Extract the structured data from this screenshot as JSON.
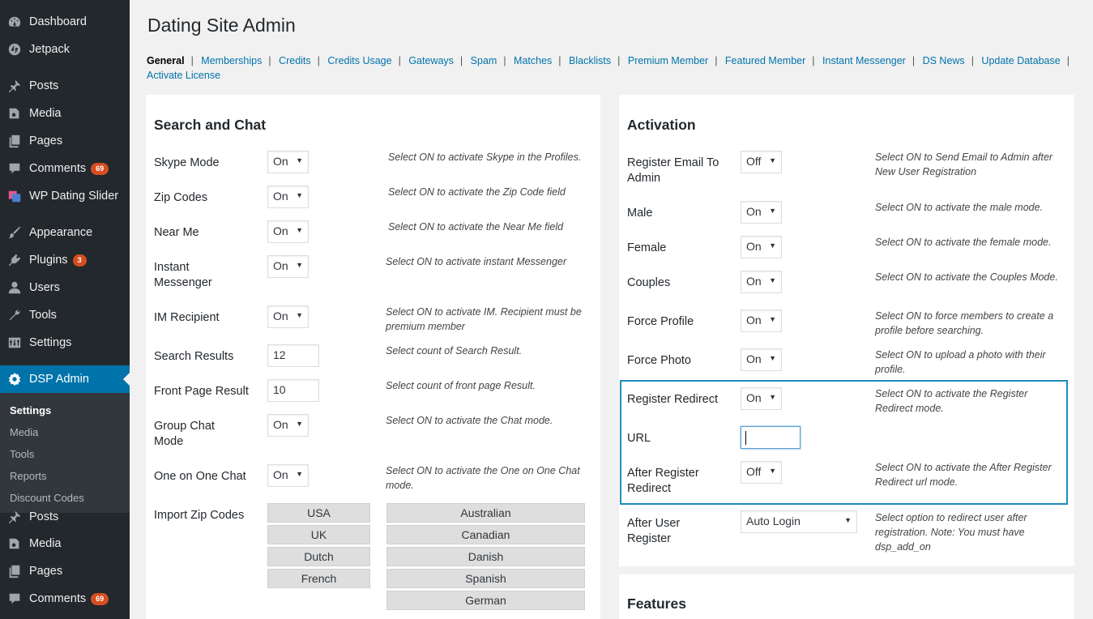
{
  "sidebar": {
    "items": [
      {
        "label": "Dashboard",
        "icon": "dashboard-icon"
      },
      {
        "label": "Jetpack",
        "icon": "jetpack-icon"
      },
      {
        "label": "Posts",
        "icon": "pin-icon"
      },
      {
        "label": "Media",
        "icon": "media-icon"
      },
      {
        "label": "Pages",
        "icon": "pages-icon"
      },
      {
        "label": "Comments",
        "icon": "comment-icon",
        "badge": "69"
      },
      {
        "label": "WP Dating Slider",
        "icon": "slider-icon"
      },
      {
        "label": "Appearance",
        "icon": "brush-icon"
      },
      {
        "label": "Plugins",
        "icon": "plugin-icon",
        "badge": "3"
      },
      {
        "label": "Users",
        "icon": "user-icon"
      },
      {
        "label": "Tools",
        "icon": "wrench-icon"
      },
      {
        "label": "Settings",
        "icon": "settings-icon"
      },
      {
        "label": "DSP Admin",
        "icon": "gear-icon"
      }
    ],
    "submenu": [
      "Settings",
      "Media",
      "Tools",
      "Reports",
      "Discount Codes"
    ],
    "below": [
      {
        "label": "Posts",
        "icon": "pin-icon"
      },
      {
        "label": "Media",
        "icon": "media-icon"
      },
      {
        "label": "Pages",
        "icon": "pages-icon"
      },
      {
        "label": "Comments",
        "icon": "comment-icon",
        "badge": "69"
      }
    ]
  },
  "page": {
    "title": "Dating Site Admin"
  },
  "tabs": [
    "General",
    "Memberships",
    "Credits",
    "Credits Usage",
    "Gateways",
    "Spam",
    "Matches",
    "Blacklists",
    "Premium Member",
    "Featured Member",
    "Instant Messenger",
    "DS News",
    "Update Database",
    "Activate License"
  ],
  "search_chat": {
    "title": "Search and Chat",
    "rows": [
      {
        "label": "Skype Mode",
        "value": "On",
        "desc": "Select ON to activate Skype in the Profiles."
      },
      {
        "label": "Zip Codes",
        "value": "On",
        "desc": "Select ON to activate the Zip Code field"
      },
      {
        "label": "Near Me",
        "value": "On",
        "desc": "Select ON to activate the Near Me field"
      },
      {
        "label": "Instant Messenger",
        "value": "On",
        "desc": "Select ON to activate instant Messenger"
      },
      {
        "label": "IM Recipient",
        "value": "On",
        "desc": "Select ON to activate IM. Recipient must be premium member"
      },
      {
        "label": "Search Results",
        "value": "12",
        "desc": "Select count of Search Result."
      },
      {
        "label": "Front Page Result",
        "value": "10",
        "desc": "Select count of front page Result."
      },
      {
        "label": "Group Chat Mode",
        "value": "On",
        "desc": "Select ON to activate the Chat mode."
      },
      {
        "label": "One on One Chat",
        "value": "On",
        "desc": "Select ON to activate the One on One Chat mode."
      }
    ],
    "import_label": "Import Zip Codes",
    "zip_left": [
      "USA",
      "UK",
      "Dutch",
      "French"
    ],
    "zip_right": [
      "Australian",
      "Canadian",
      "Danish",
      "Spanish",
      "German"
    ]
  },
  "activation": {
    "title": "Activation",
    "rows": [
      {
        "label": "Register Email To Admin",
        "value": "Off",
        "desc": "Select ON to Send Email to Admin after New User Registration"
      },
      {
        "label": "Male",
        "value": "On",
        "desc": "Select ON to activate the male mode."
      },
      {
        "label": "Female",
        "value": "On",
        "desc": "Select ON to activate the female mode."
      },
      {
        "label": "Couples",
        "value": "On",
        "desc": "Select ON to activate the Couples Mode."
      },
      {
        "label": "Force Profile",
        "value": "On",
        "desc": "Select ON to force members to create a profile before searching."
      },
      {
        "label": "Force Photo",
        "value": "On",
        "desc": "Select ON to upload a photo with their profile."
      },
      {
        "label": "Register Redirect",
        "value": "On",
        "desc": "Select ON to activate the Register Redirect mode."
      },
      {
        "label": "URL",
        "value": ""
      },
      {
        "label": "After Register Redirect",
        "value": "Off",
        "desc": "Select ON to activate the After Register Redirect url mode."
      },
      {
        "label": "After User Register",
        "value": "Auto Login",
        "desc": "Select option to redirect user after registration. Note: You must have dsp_add_on"
      }
    ]
  },
  "features": {
    "title": "Features"
  }
}
